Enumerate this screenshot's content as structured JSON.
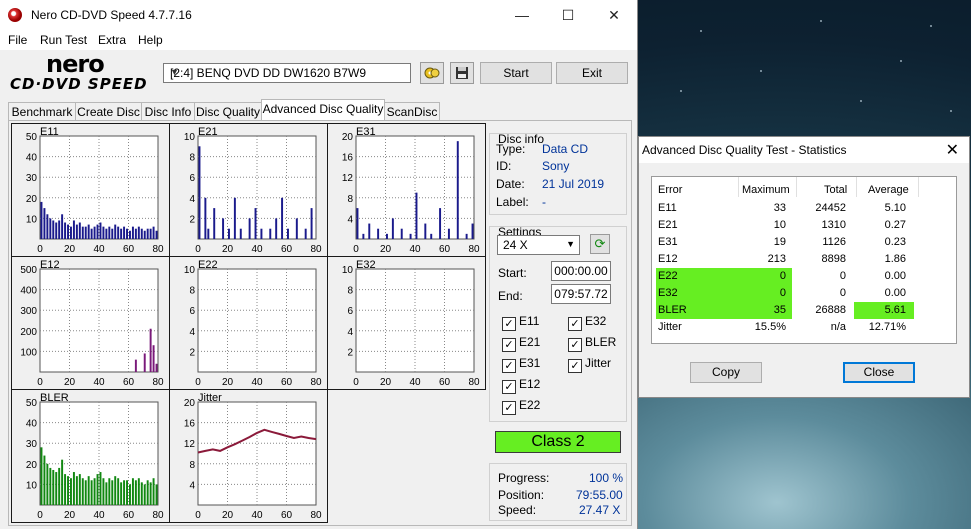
{
  "window": {
    "title": "Nero CD-DVD Speed 4.7.7.16",
    "minimize": "—",
    "maximize": "☐",
    "close": "✕"
  },
  "menu": [
    "File",
    "Run Test",
    "Extra",
    "Help"
  ],
  "logo": {
    "top": "nero",
    "bottom": "CD·DVD SPEED"
  },
  "toolbar": {
    "drive": "[2:4]  BENQ DVD DD DW1620 B7W9",
    "start": "Start",
    "exit": "Exit"
  },
  "tabs": [
    "Benchmark",
    "Create Disc",
    "Disc Info",
    "Disc Quality",
    "Advanced Disc Quality",
    "ScanDisc"
  ],
  "active_tab": "Advanced Disc Quality",
  "disc_info": {
    "title": "Disc info",
    "rows": [
      {
        "label": "Type:",
        "value": "Data CD"
      },
      {
        "label": "ID:",
        "value": "Sony"
      },
      {
        "label": "Date:",
        "value": "21 Jul 2019"
      },
      {
        "label": "Label:",
        "value": "-"
      }
    ]
  },
  "settings": {
    "title": "Settings",
    "speed": "24 X",
    "start_label": "Start:",
    "start": "000:00.00",
    "end_label": "End:",
    "end": "079:57.72",
    "checks": [
      {
        "label": "E11",
        "checked": true
      },
      {
        "label": "E32",
        "checked": true
      },
      {
        "label": "E21",
        "checked": true
      },
      {
        "label": "BLER",
        "checked": true
      },
      {
        "label": "E31",
        "checked": true
      },
      {
        "label": "Jitter",
        "checked": true
      },
      {
        "label": "E12",
        "checked": true
      },
      {
        "label": "E22",
        "checked": true
      }
    ]
  },
  "class_label": "Class 2",
  "class_color": "#66ee22",
  "progress": {
    "progress_label": "Progress:",
    "progress": "100 %",
    "position_label": "Position:",
    "position": "79:55.00",
    "speed_label": "Speed:",
    "speed": "27.47 X"
  },
  "chart_data": [
    {
      "type": "bar",
      "title": "E11",
      "ylim": [
        0,
        50
      ],
      "yticks": [
        "50",
        "40",
        "30",
        "20",
        "10"
      ],
      "xticks": [
        "0",
        "20",
        "40",
        "60",
        "80"
      ],
      "color": "#1a1a8c",
      "values": [
        18,
        15,
        12,
        10,
        9,
        8,
        9,
        12,
        8,
        7,
        6,
        9,
        7,
        8,
        6,
        6,
        7,
        5,
        6,
        7,
        8,
        6,
        5,
        6,
        5,
        7,
        6,
        5,
        6,
        5,
        4,
        6,
        5,
        6,
        5,
        4,
        5,
        5,
        6,
        4
      ]
    },
    {
      "type": "bar",
      "title": "E21",
      "ylim": [
        0,
        10
      ],
      "yticks": [
        "10",
        "8",
        "6",
        "4",
        "2"
      ],
      "xticks": [
        "0",
        "20",
        "40",
        "60",
        "80"
      ],
      "color": "#1a1a8c",
      "values": [
        9,
        0,
        4,
        1,
        0,
        3,
        0,
        0,
        2,
        0,
        1,
        0,
        4,
        0,
        1,
        0,
        0,
        2,
        0,
        3,
        0,
        1,
        0,
        0,
        1,
        0,
        2,
        0,
        4,
        0,
        1,
        0,
        0,
        2,
        0,
        0,
        1,
        0,
        3,
        0
      ]
    },
    {
      "type": "bar",
      "title": "E31",
      "ylim": [
        0,
        20
      ],
      "yticks": [
        "20",
        "16",
        "12",
        "8",
        "4"
      ],
      "xticks": [
        "0",
        "20",
        "40",
        "60",
        "80"
      ],
      "color": "#1a1a8c",
      "values": [
        6,
        0,
        1,
        0,
        3,
        0,
        0,
        2,
        0,
        0,
        1,
        0,
        4,
        0,
        0,
        2,
        0,
        0,
        1,
        0,
        9,
        0,
        0,
        3,
        0,
        1,
        0,
        0,
        6,
        0,
        0,
        2,
        0,
        0,
        19,
        0,
        0,
        1,
        0,
        3
      ]
    },
    {
      "type": "bar",
      "title": "E12",
      "ylim": [
        0,
        500
      ],
      "yticks": [
        "500",
        "400",
        "300",
        "200",
        "100"
      ],
      "xticks": [
        "0",
        "20",
        "40",
        "60",
        "80"
      ],
      "color": "#7a1a7a",
      "values": [
        0,
        0,
        0,
        0,
        0,
        0,
        0,
        0,
        0,
        0,
        0,
        0,
        0,
        0,
        0,
        0,
        0,
        0,
        0,
        0,
        0,
        0,
        0,
        0,
        0,
        0,
        0,
        0,
        0,
        0,
        0,
        0,
        60,
        0,
        0,
        90,
        0,
        210,
        130,
        40
      ]
    },
    {
      "type": "bar",
      "title": "E22",
      "ylim": [
        0,
        10
      ],
      "yticks": [
        "10",
        "8",
        "6",
        "4",
        "2"
      ],
      "xticks": [
        "0",
        "20",
        "40",
        "60",
        "80"
      ],
      "color": "#1a1a8c",
      "values": []
    },
    {
      "type": "bar",
      "title": "E32",
      "ylim": [
        0,
        10
      ],
      "yticks": [
        "10",
        "8",
        "6",
        "4",
        "2"
      ],
      "xticks": [
        "0",
        "20",
        "40",
        "60",
        "80"
      ],
      "color": "#1a1a8c",
      "values": []
    },
    {
      "type": "bar",
      "title": "BLER",
      "ylim": [
        0,
        50
      ],
      "yticks": [
        "50",
        "40",
        "30",
        "20",
        "10"
      ],
      "xticks": [
        "0",
        "20",
        "40",
        "60",
        "80"
      ],
      "color": "#118811",
      "values": [
        28,
        24,
        20,
        18,
        17,
        16,
        18,
        22,
        15,
        14,
        13,
        16,
        14,
        15,
        13,
        12,
        14,
        12,
        13,
        15,
        16,
        13,
        11,
        13,
        12,
        14,
        13,
        11,
        12,
        12,
        10,
        13,
        12,
        13,
        11,
        10,
        12,
        11,
        13,
        10
      ]
    },
    {
      "type": "line",
      "title": "Jitter",
      "ylim": [
        0,
        20
      ],
      "yticks": [
        "20",
        "16",
        "12",
        "8",
        "4"
      ],
      "xticks": [
        "0",
        "20",
        "40",
        "60",
        "80"
      ],
      "color": "#8b1a3a",
      "x": [
        0,
        5,
        10,
        15,
        20,
        25,
        30,
        35,
        40,
        45,
        50,
        55,
        60,
        65,
        70,
        75,
        80
      ],
      "values": [
        10.2,
        10.5,
        10.8,
        10.5,
        11.2,
        11.8,
        12.5,
        13.2,
        14.0,
        14.6,
        14.2,
        13.8,
        13.4,
        13.0,
        13.3,
        13.0,
        12.8
      ]
    }
  ],
  "stats": {
    "title": "Advanced Disc Quality Test - Statistics",
    "close_icon": "✕",
    "headers": [
      "Error",
      "Maximum",
      "Total",
      "Average"
    ],
    "rows": [
      {
        "name": "E11",
        "max": "33",
        "total": "24452",
        "avg": "5.10",
        "hl_name": false,
        "hl_avg": false
      },
      {
        "name": "E21",
        "max": "10",
        "total": "1310",
        "avg": "0.27",
        "hl_name": false,
        "hl_avg": false
      },
      {
        "name": "E31",
        "max": "19",
        "total": "1126",
        "avg": "0.23",
        "hl_name": false,
        "hl_avg": false
      },
      {
        "name": "E12",
        "max": "213",
        "total": "8898",
        "avg": "1.86",
        "hl_name": false,
        "hl_avg": false
      },
      {
        "name": "E22",
        "max": "0",
        "total": "0",
        "avg": "0.00",
        "hl_name": true,
        "hl_avg": false
      },
      {
        "name": "E32",
        "max": "0",
        "total": "0",
        "avg": "0.00",
        "hl_name": true,
        "hl_avg": false
      },
      {
        "name": "BLER",
        "max": "35",
        "total": "26888",
        "avg": "5.61",
        "hl_name": true,
        "hl_avg": true
      },
      {
        "name": "Jitter",
        "max": "15.5%",
        "total": "n/a",
        "avg": "12.71%",
        "hl_name": false,
        "hl_avg": false
      }
    ],
    "highlight_color": "#66ee22",
    "copy": "Copy",
    "close": "Close"
  }
}
